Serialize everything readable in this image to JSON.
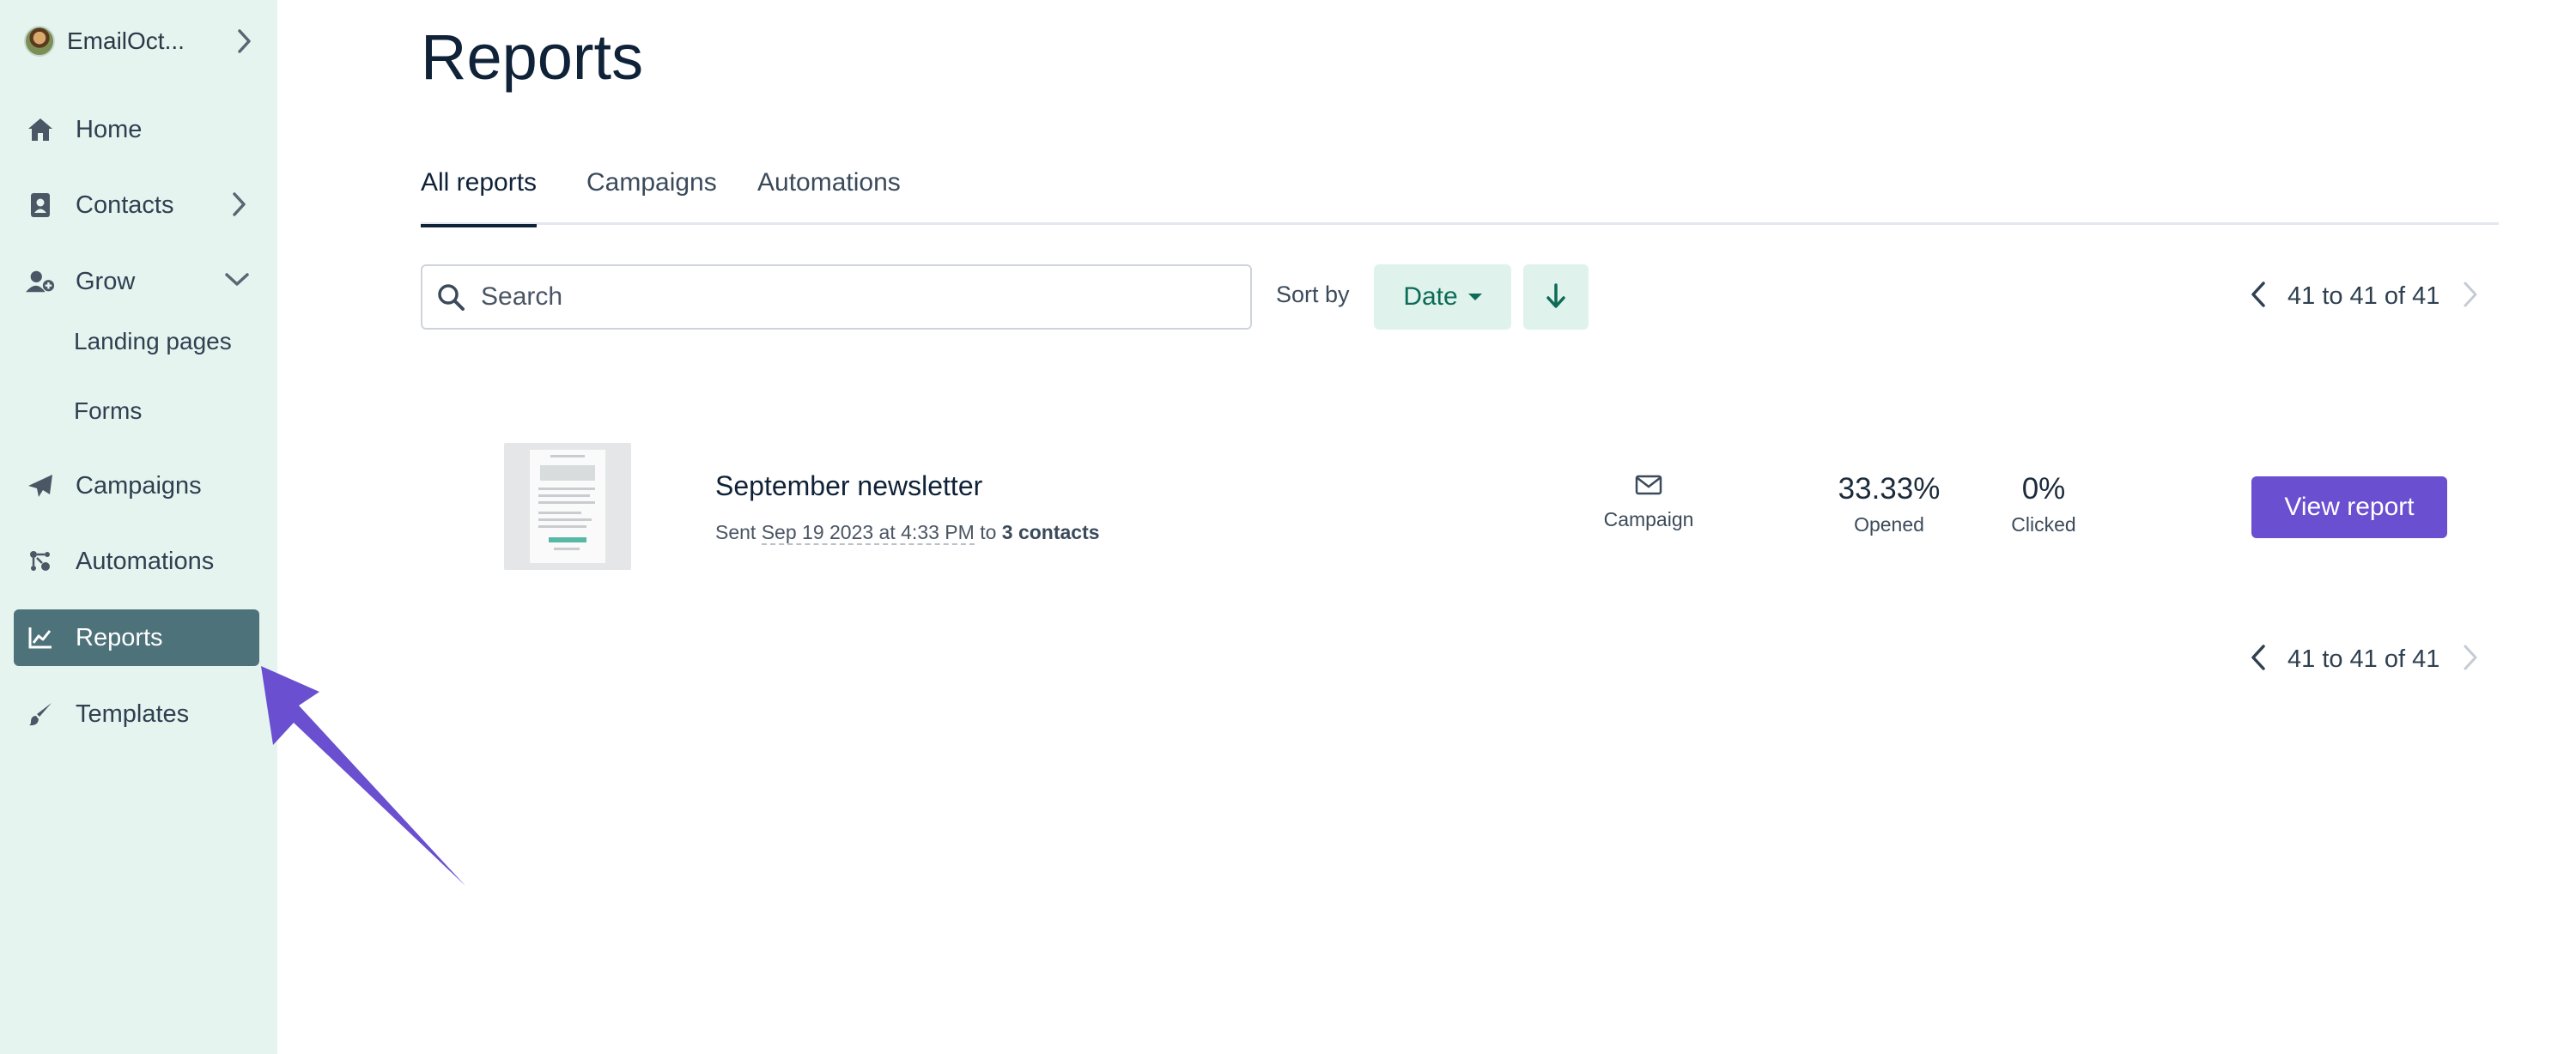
{
  "sidebar": {
    "account": {
      "name": "EmailOct..."
    },
    "items": [
      {
        "label": "Home",
        "icon": "home-icon"
      },
      {
        "label": "Contacts",
        "icon": "contacts-icon"
      },
      {
        "label": "Grow",
        "icon": "user-plus-icon"
      },
      {
        "label": "Campaigns",
        "icon": "paper-plane-icon"
      },
      {
        "label": "Automations",
        "icon": "automation-icon"
      },
      {
        "label": "Reports",
        "icon": "chart-line-icon",
        "active": true
      },
      {
        "label": "Templates",
        "icon": "brush-icon"
      }
    ],
    "grow_subitems": [
      {
        "label": "Landing pages"
      },
      {
        "label": "Forms"
      }
    ]
  },
  "page": {
    "title": "Reports",
    "tabs": [
      {
        "label": "All reports",
        "active": true
      },
      {
        "label": "Campaigns"
      },
      {
        "label": "Automations"
      }
    ],
    "search": {
      "placeholder": "Search",
      "value": ""
    },
    "sort": {
      "label": "Sort by",
      "selected": "Date"
    },
    "pagination": {
      "text": "41 to 41 of 41"
    },
    "reports": [
      {
        "name": "September newsletter",
        "sent_prefix": "Sent",
        "sent_date": "Sep 19 2023 at 4:33 PM",
        "sent_to": "to",
        "contacts": "3 contacts",
        "type": "Campaign",
        "opened_value": "33.33%",
        "opened_label": "Opened",
        "clicked_value": "0%",
        "clicked_label": "Clicked",
        "action_label": "View report"
      }
    ]
  },
  "colors": {
    "sidebar_bg": "#e6f4f0",
    "active_nav": "#4e7279",
    "primary_button": "#6a4fd0",
    "sort_button_bg": "#e0f2ec",
    "annotation_arrow": "#6a4fd0"
  }
}
